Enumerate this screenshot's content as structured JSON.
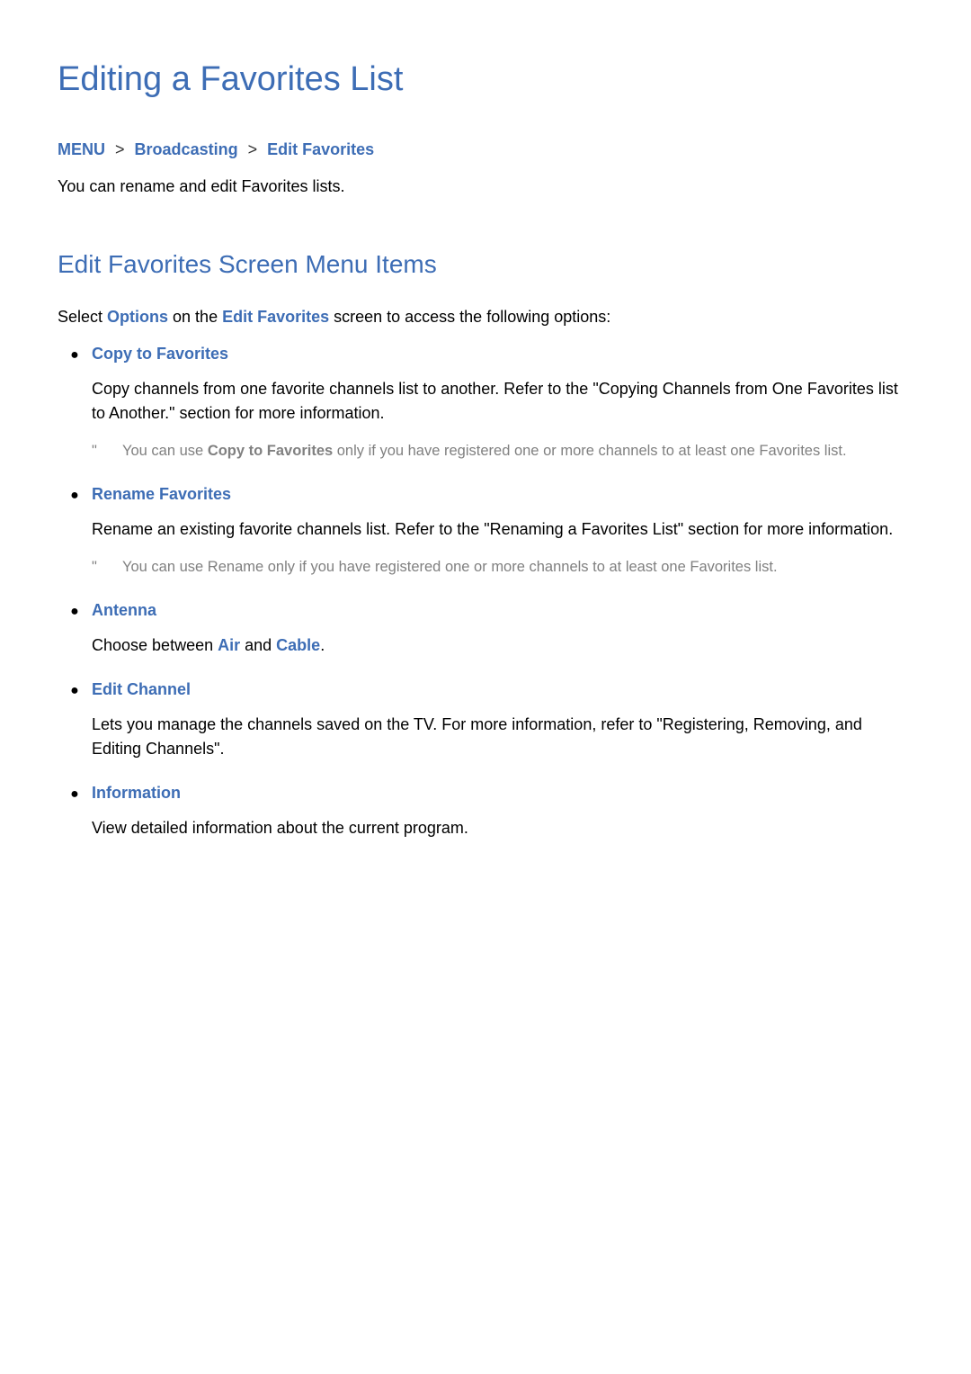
{
  "page": {
    "title": "Editing a Favorites List",
    "breadcrumb": {
      "menu": "MENU",
      "broadcasting": "Broadcasting",
      "edit_favorites": "Edit Favorites",
      "sep": ">"
    },
    "intro": "You can rename and edit Favorites lists.",
    "section_heading": "Edit Favorites Screen Menu Items",
    "select_prefix": "Select ",
    "options_word": "Options",
    "select_mid": " on the ",
    "edit_fav_word": "Edit Favorites",
    "select_suffix": " screen to access the following options:"
  },
  "items": [
    {
      "title": "Copy to Favorites",
      "desc": "Copy channels from one favorite channels list to another. Refer to the \"Copying Channels from One Favorites list to Another.\" section for more information.",
      "note_prefix": "You can use ",
      "note_bold": "Copy to Favorites",
      "note_suffix": " only if you have registered one or more channels to at least one Favorites list."
    },
    {
      "title": "Rename Favorites",
      "desc": "Rename an existing favorite channels list. Refer to the \"Renaming a Favorites List\" section for more information.",
      "note_full": "You can use Rename only if you have registered one or more channels to at least one Favorites list."
    },
    {
      "title": "Antenna",
      "desc_prefix": "Choose between ",
      "desc_hl1": "Air",
      "desc_mid": " and ",
      "desc_hl2": "Cable",
      "desc_suffix": "."
    },
    {
      "title": "Edit Channel",
      "desc": "Lets you manage the channels saved on the TV. For more information, refer to \"Registering, Removing, and Editing Channels\"."
    },
    {
      "title": "Information",
      "desc": "View detailed information about the current program."
    }
  ],
  "glyphs": {
    "bullet": "●",
    "note_mark": "\""
  }
}
